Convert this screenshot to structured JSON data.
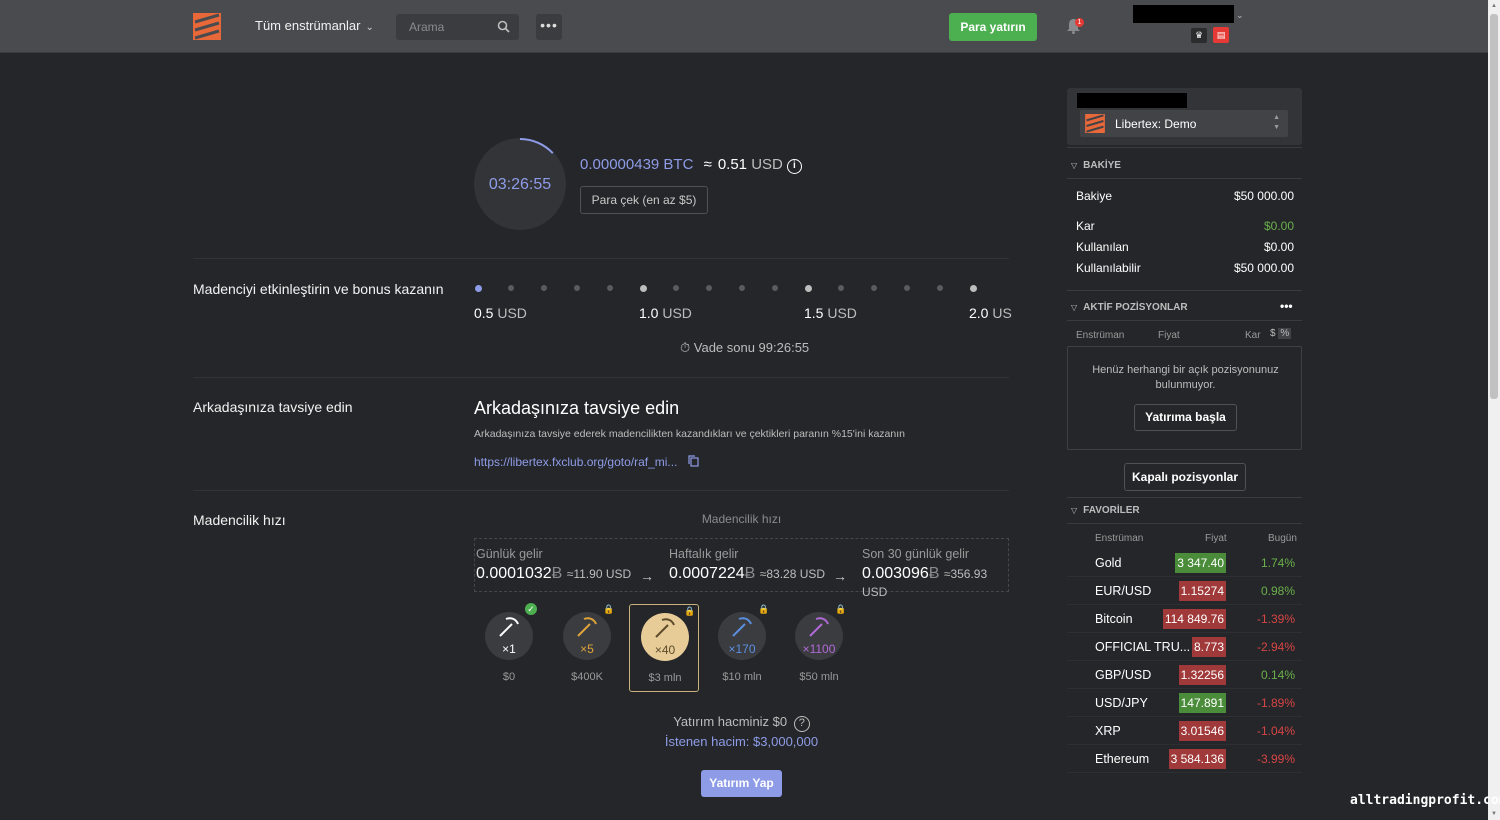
{
  "header": {
    "instruments_label": "Tüm enstrümanlar",
    "search_placeholder": "Arama",
    "more_label": "•••",
    "deposit_label": "Para yatırın",
    "notification_count": "1"
  },
  "miner": {
    "timer": "03:26:55",
    "btc_value": "0.00000439",
    "btc_unit": "BTC",
    "approx": "≈",
    "usd_value": "0.51",
    "usd_unit": "USD",
    "info": "i",
    "withdraw_label": "Para çek (en az $5)",
    "timer_progress": 0.13
  },
  "bonus": {
    "title": "Madenciyi etkinleştirin ve bonus kazanın",
    "ticks": [
      {
        "value": "0.5",
        "unit": "USD"
      },
      {
        "value": "1.0",
        "unit": "USD"
      },
      {
        "value": "1.5",
        "unit": "USD"
      },
      {
        "value": "2.0",
        "unit": "US"
      }
    ],
    "expiry": "⏱ Vade sonu 99:26:55"
  },
  "referral": {
    "section_title": "Arkadaşınıza tavsiye edin",
    "heading": "Arkadaşınıza tavsiye edin",
    "subtitle": "Arkadaşınıza tavsiye ederek madencilikten kazandıkları ve çektikleri paranın %15'ini kazanın",
    "link": "https://libertex.fxclub.org/goto/raf_mi..."
  },
  "mining": {
    "section_title": "Madencilik hızı",
    "caption": "Madencilik hızı",
    "income": [
      {
        "label": "Günlük gelir",
        "value": "0.0001032",
        "btc": "Ƀ",
        "usd": "≈11.90 USD"
      },
      {
        "label": "Haftalık gelir",
        "value": "0.0007224",
        "btc": "Ƀ",
        "usd": "≈83.28 USD"
      },
      {
        "label": "Son 30 günlük gelir",
        "value": "0.003096",
        "btc": "Ƀ",
        "usd": "≈356.93 USD"
      }
    ],
    "arrow": "→",
    "levels": [
      {
        "mult": "×1",
        "price": "$0",
        "color": "#ffffff",
        "badge": "✓",
        "badge_color": "#4caf50"
      },
      {
        "mult": "×5",
        "price": "$400K",
        "color": "#e0a43a",
        "badge": "🔒",
        "badge_color": "#e0a43a"
      },
      {
        "mult": "×40",
        "price": "$3 mln",
        "color": "#5a4a2a",
        "badge": "🔒",
        "badge_color": "#8a8b8e"
      },
      {
        "mult": "×170",
        "price": "$10 mln",
        "color": "#5b8fe0",
        "badge": "🔒",
        "badge_color": "#5b8fe0"
      },
      {
        "mult": "×1100",
        "price": "$50 mln",
        "color": "#b26ad8",
        "badge": "🔒",
        "badge_color": "#b26ad8"
      }
    ],
    "investment_volume": "Yatırım hacminiz $0",
    "help": "?",
    "required_volume": "İstenen hacim: $3,000,000",
    "invest_label": "Yatırım Yap"
  },
  "sidebar": {
    "account_name": "Libertex: Demo",
    "balance_header": "BAKİYE",
    "balance_rows": [
      {
        "label": "Bakiye",
        "value": "$50 000.00",
        "color": "#ffffff"
      },
      {
        "label": "Kar",
        "value": "$0.00",
        "color": "#6ab04c"
      },
      {
        "label": "Kullanılan",
        "value": "$0.00",
        "color": "#ffffff"
      },
      {
        "label": "Kullanılabilir",
        "value": "$50 000.00",
        "color": "#ffffff"
      }
    ],
    "positions_header": "AKTİF POZİSYONLAR",
    "positions_more": "•••",
    "positions_cols": {
      "instrument": "Enstrüman",
      "price": "Fiyat",
      "profit": "Kar",
      "dollar": "$",
      "percent": "%"
    },
    "no_positions": "Henüz herhangi bir açık pozisyonunuz bulunmuyor.",
    "start_investing": "Yatırıma başla",
    "closed_positions": "Kapalı pozisyonlar",
    "favorites_header": "FAVORİLER",
    "favorites_cols": {
      "instrument": "Enstrüman",
      "price": "Fiyat",
      "today": "Bugün"
    },
    "favorites": [
      {
        "name": "Gold",
        "price": "3 347.40",
        "change": "1.74%",
        "up": true
      },
      {
        "name": "EUR/USD",
        "price": "1.15274",
        "change": "0.98%",
        "up": false
      },
      {
        "name": "Bitcoin",
        "price": "114 849.76",
        "change": "-1.39%",
        "up": false
      },
      {
        "name": "OFFICIAL TRU...",
        "price": "8.773",
        "change": "-2.94%",
        "up": false
      },
      {
        "name": "GBP/USD",
        "price": "1.32256",
        "change": "0.14%",
        "up": false
      },
      {
        "name": "USD/JPY",
        "price": "147.891",
        "change": "-1.89%",
        "up": true
      },
      {
        "name": "XRP",
        "price": "3.01546",
        "change": "-1.04%",
        "up": false
      },
      {
        "name": "Ethereum",
        "price": "3 584.136",
        "change": "-3.99%",
        "up": false
      }
    ]
  },
  "watermark": "alltradingprofit.com",
  "colors": {
    "accent": "#8e9ce8",
    "green": "#4caf50",
    "red": "#d64545",
    "bg": "#252629"
  }
}
